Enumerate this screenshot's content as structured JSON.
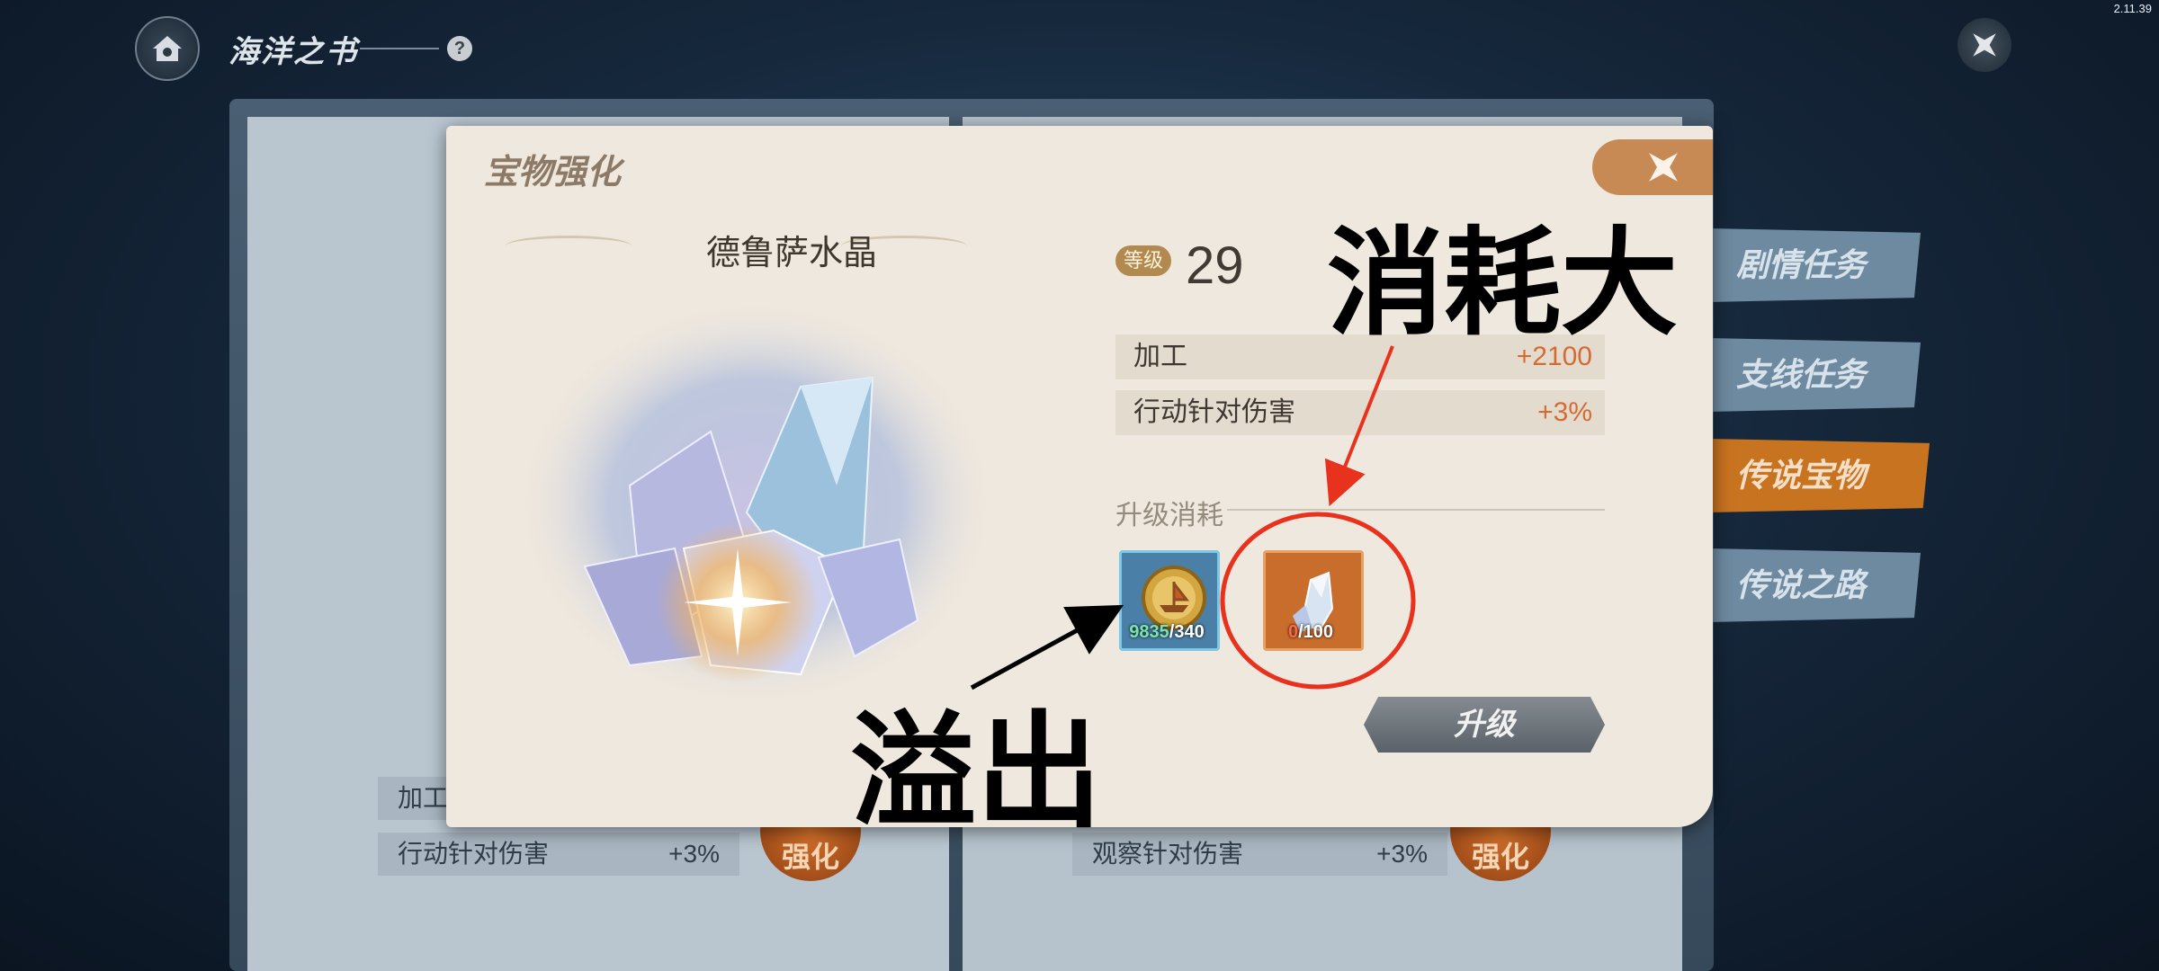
{
  "version": "2.11.39",
  "header": {
    "title": "海洋之书",
    "help_label": "?"
  },
  "side_tabs": [
    "剧情任务",
    "支线任务",
    "传说宝物",
    "传说之路"
  ],
  "background_cards": {
    "left": {
      "row1_label": "加工",
      "row2_label": "行动针对伤害",
      "row2_value": "+3%",
      "button": "强化"
    },
    "right": {
      "row2_label": "观察针对伤害",
      "row2_value": "+3%",
      "button": "强化"
    }
  },
  "modal": {
    "title": "宝物强化",
    "item_name": "德鲁萨水晶",
    "level_label": "等级",
    "level_value": "29",
    "stats": [
      {
        "label": "加工",
        "value": "+2100"
      },
      {
        "label": "行动针对伤害",
        "value": "+3%"
      }
    ],
    "cost_label": "升级消耗",
    "costs": [
      {
        "icon": "ship-coin-icon",
        "have": "9835",
        "need": "/340"
      },
      {
        "icon": "crystal-icon",
        "have": "0",
        "need": "/100"
      }
    ],
    "upgrade_button": "升级"
  },
  "annotations": {
    "overflow": "溢出",
    "high_cost": "消耗大"
  },
  "colors": {
    "accent_orange": "#d46b34",
    "annotation_red": "#e8321e",
    "tab_active": "#c8731f"
  }
}
